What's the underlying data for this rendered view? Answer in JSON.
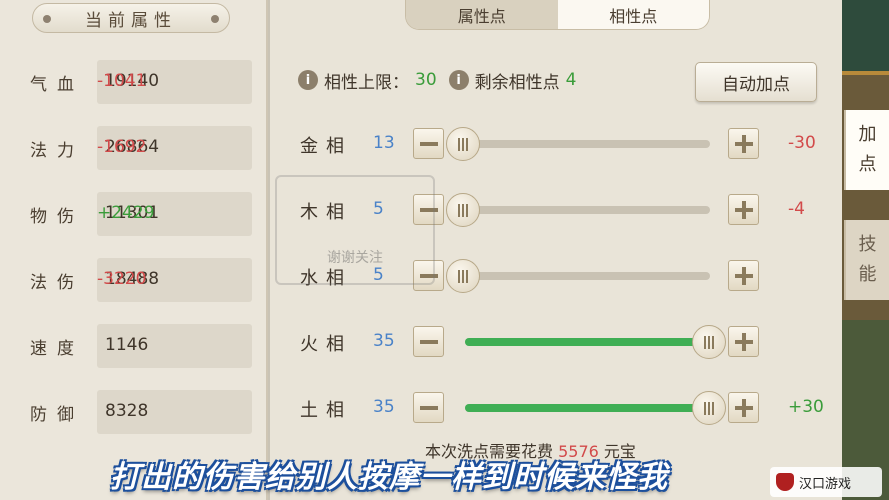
{
  "left_panel": {
    "title": "当前属性",
    "stats": [
      {
        "name": "气血",
        "value": "19140",
        "delta": "-1041",
        "delta_type": "neg"
      },
      {
        "name": "法力",
        "value": "26864",
        "delta": "-1692",
        "delta_type": "neg"
      },
      {
        "name": "物伤",
        "value": "11301",
        "delta": "+2429",
        "delta_type": "pos"
      },
      {
        "name": "法伤",
        "value": "18488",
        "delta": "-3220",
        "delta_type": "neg"
      },
      {
        "name": "速度",
        "value": "1146",
        "delta": "",
        "delta_type": ""
      },
      {
        "name": "防御",
        "value": "8328",
        "delta": "",
        "delta_type": ""
      }
    ]
  },
  "tabs": [
    {
      "label": "属性点",
      "active": false
    },
    {
      "label": "相性点",
      "active": true
    }
  ],
  "info": {
    "limit_label": "相性上限：",
    "limit_value": "30",
    "remaining_label": "剩余相性点",
    "remaining_value": "4",
    "info_icon": "i"
  },
  "auto_button": "自动加点",
  "affinities": [
    {
      "name": "金相",
      "value": "13",
      "level": 0,
      "delta": "-30",
      "delta_type": "neg"
    },
    {
      "name": "木相",
      "value": "5",
      "level": 0,
      "delta": "-4",
      "delta_type": "neg"
    },
    {
      "name": "水相",
      "value": "5",
      "level": 0,
      "delta": "",
      "delta_type": ""
    },
    {
      "name": "火相",
      "value": "35",
      "level": 1,
      "delta": "",
      "delta_type": ""
    },
    {
      "name": "土相",
      "value": "35",
      "level": 1,
      "delta": "+30",
      "delta_type": "pos"
    }
  ],
  "cost": {
    "prefix": "本次洗点需要花费",
    "amount": "5576",
    "unit": "元宝"
  },
  "side_tabs": [
    {
      "label_top": "加",
      "label_bottom": "点",
      "active": true
    },
    {
      "label_top": "技",
      "label_bottom": "能",
      "active": false
    }
  ],
  "subtitle": "打出的伤害给别人按摩一样到时候来怪我",
  "watermark_text": "谢谢关注",
  "brand_text": "汉口游戏"
}
